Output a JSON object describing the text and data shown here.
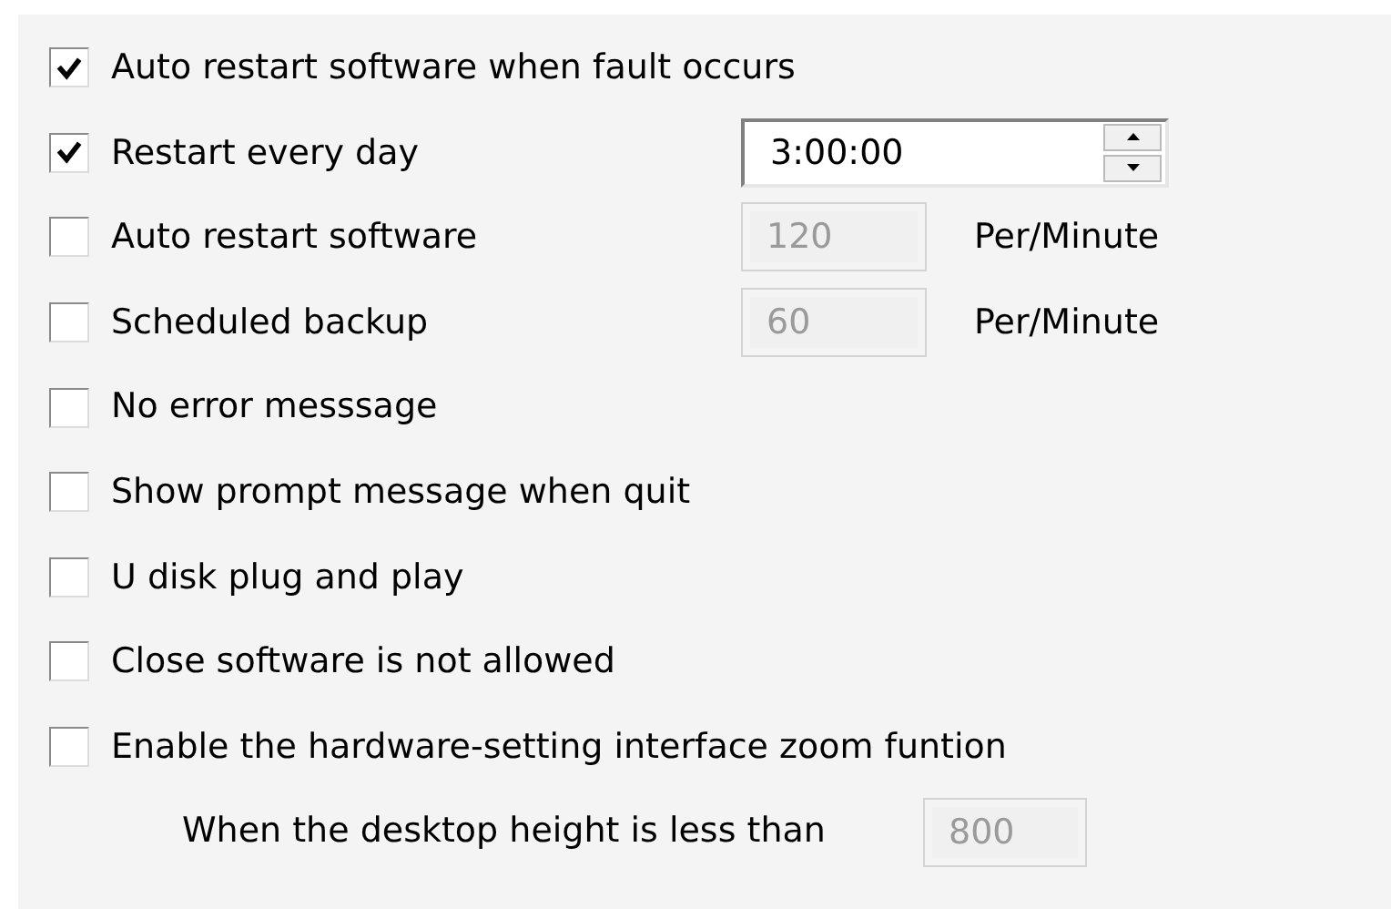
{
  "options": [
    {
      "kind": "check",
      "label": "Auto restart software when fault occurs",
      "checked": true
    },
    {
      "kind": "time",
      "label": "Restart every day",
      "checked": true,
      "time": {
        "value": "3:00:00"
      }
    },
    {
      "kind": "rate",
      "label": "Auto restart software",
      "checked": false,
      "field": {
        "value": "120",
        "disabled": true
      },
      "unit": "Per/Minute"
    },
    {
      "kind": "rate",
      "label": "Scheduled backup",
      "checked": false,
      "field": {
        "value": "60",
        "disabled": true
      },
      "unit": "Per/Minute"
    },
    {
      "kind": "check",
      "label": "No error messsage",
      "checked": false
    },
    {
      "kind": "check",
      "label": "Show prompt message when quit",
      "checked": false
    },
    {
      "kind": "check",
      "label": "U disk plug and play",
      "checked": false
    },
    {
      "kind": "check",
      "label": "Close software is not allowed",
      "checked": false
    },
    {
      "kind": "check",
      "label": "Enable the hardware-setting interface zoom funtion",
      "checked": false
    }
  ],
  "zoom_threshold": {
    "label": "When the desktop height is less than",
    "value": "800",
    "disabled": true
  }
}
